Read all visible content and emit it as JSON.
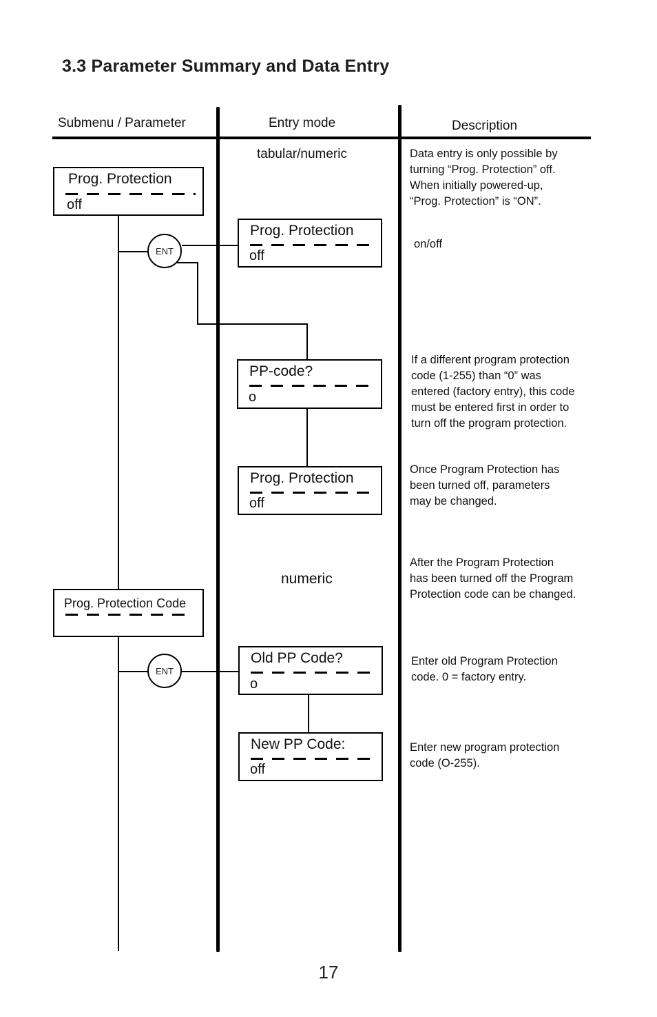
{
  "page": {
    "section_title": "3.3 Parameter Summary and Data Entry",
    "page_number": "17"
  },
  "columns": {
    "submenu": "Submenu / Parameter",
    "entry_mode": "Entry mode",
    "description": "Description"
  },
  "entry_modes": {
    "first": "tabular/numeric",
    "second": "numeric"
  },
  "submenus": [
    {
      "line1": "Prog. Protection",
      "line2": "off"
    },
    {
      "line1": "Prog. Protection Code",
      "line2": ""
    }
  ],
  "ent_icons": [
    {
      "label": "ENT"
    },
    {
      "label": "ENT"
    }
  ],
  "entry_boxes": [
    {
      "line1": "Prog. Protection",
      "line2": "off"
    },
    {
      "line1": "PP-code?",
      "line2": "o"
    },
    {
      "line1": "Prog. Protection",
      "line2": "off"
    },
    {
      "line1": "Old PP Code?",
      "line2": "o"
    },
    {
      "line1": "New PP Code:",
      "line2": "off"
    }
  ],
  "descriptions": [
    {
      "lines": [
        "Data entry is only possible by",
        "turning “Prog. Protection” off.",
        "When initially powered-up,",
        "“Prog. Protection” is “ON”."
      ]
    },
    {
      "lines": [
        "on/off"
      ]
    },
    {
      "lines": [
        "If a different program protection",
        "code (1-255) than “0” was",
        "entered (factory entry), this code",
        "must be entered first in order to",
        "turn off the program protection."
      ]
    },
    {
      "lines": [
        "Once Program Protection has",
        "been turned off, parameters",
        "may be changed."
      ]
    },
    {
      "lines": [
        "After the Program Protection",
        "has been turned off the Program",
        "Protection code can be changed."
      ]
    },
    {
      "lines": [
        "Enter old Program Protection",
        "code. 0 = factory entry."
      ]
    },
    {
      "lines": [
        "Enter new program protection",
        "code (O-255)."
      ]
    }
  ]
}
